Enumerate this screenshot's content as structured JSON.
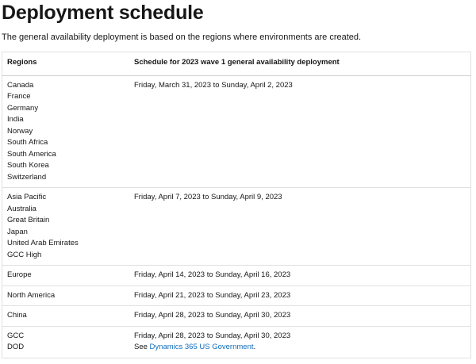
{
  "page": {
    "title": "Deployment schedule",
    "intro": "The general availability deployment is based on the regions where environments are created."
  },
  "table": {
    "headers": {
      "regions": "Regions",
      "schedule": "Schedule for 2023 wave 1 general availability deployment"
    },
    "rows": [
      {
        "regions": [
          "Canada",
          "France",
          "Germany",
          "India",
          "Norway",
          "South Africa",
          "South America",
          "South Korea",
          "Switzerland"
        ],
        "schedule": "Friday, March 31, 2023 to Sunday, April 2, 2023"
      },
      {
        "regions": [
          "Asia Pacific",
          "Australia",
          "Great Britain",
          "Japan",
          "United Arab Emirates",
          "GCC High"
        ],
        "schedule": "Friday, April 7, 2023 to Sunday, April 9, 2023"
      },
      {
        "regions": [
          "Europe"
        ],
        "schedule": "Friday, April 14, 2023 to Sunday, April 16, 2023"
      },
      {
        "regions": [
          "North America"
        ],
        "schedule": "Friday, April 21, 2023 to Sunday, April 23, 2023"
      },
      {
        "regions": [
          "China"
        ],
        "schedule": "Friday, April 28, 2023 to Sunday, April 30, 2023"
      },
      {
        "regions": [
          "GCC",
          "DOD"
        ],
        "schedule": "Friday, April 28, 2023 to Sunday, April 30, 2023",
        "note_prefix": "See ",
        "note_link": "Dynamics 365 US Government",
        "note_suffix": "."
      }
    ]
  },
  "colors": {
    "link": "#0f6cbd",
    "text": "#171717",
    "border": "#e1e1e1"
  }
}
